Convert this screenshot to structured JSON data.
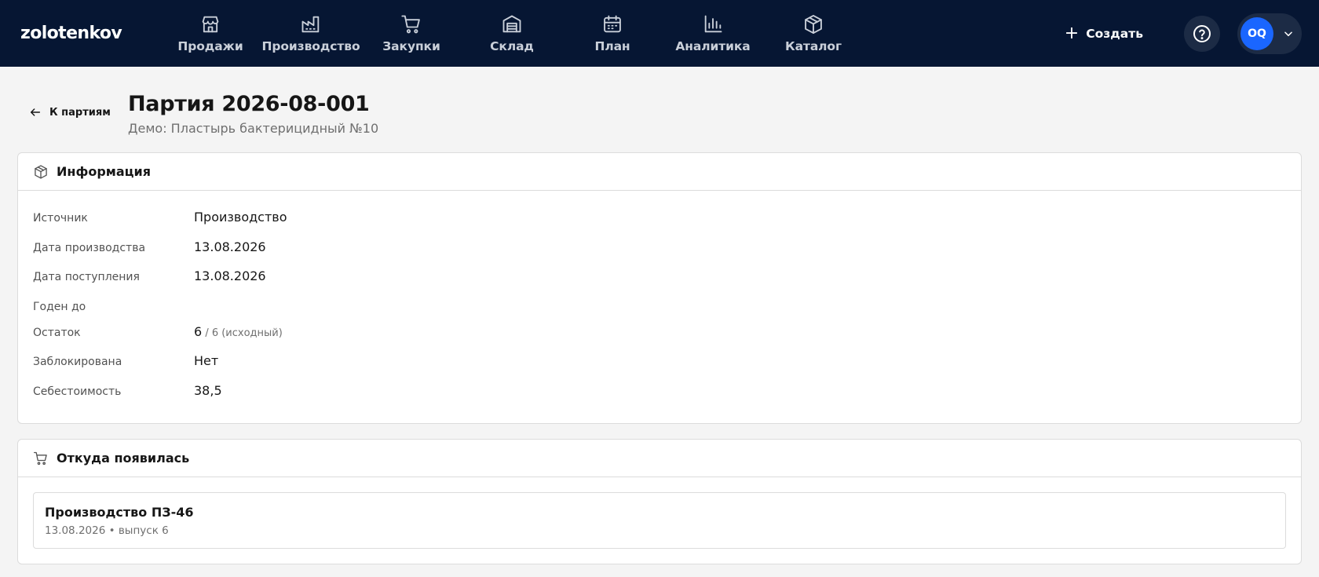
{
  "app": {
    "logo": "zolotenkov"
  },
  "nav": [
    {
      "id": "sales",
      "label": "Продажи",
      "icon": "store-icon"
    },
    {
      "id": "production",
      "label": "Производство",
      "icon": "factory-icon"
    },
    {
      "id": "purchases",
      "label": "Закупки",
      "icon": "cart-icon"
    },
    {
      "id": "warehouse",
      "label": "Склад",
      "icon": "warehouse-icon"
    },
    {
      "id": "plan",
      "label": "План",
      "icon": "calendar-icon"
    },
    {
      "id": "analytics",
      "label": "Аналитика",
      "icon": "bar-chart-icon"
    },
    {
      "id": "catalog",
      "label": "Каталог",
      "icon": "package-icon"
    }
  ],
  "header": {
    "create_label": "Создать",
    "user_initials": "OQ"
  },
  "page": {
    "back_label": "К партиям",
    "title": "Партия 2026-08-001",
    "subtitle": "Демо: Пластырь бактерицидный №10"
  },
  "info": {
    "title": "Информация",
    "rows": [
      {
        "label": "Источник",
        "value": "Производство"
      },
      {
        "label": "Дата производства",
        "value": "13.08.2026"
      },
      {
        "label": "Дата поступления",
        "value": "13.08.2026"
      },
      {
        "label": "Годен до",
        "value": ""
      },
      {
        "label": "Остаток",
        "value": "6",
        "sub": " / 6 (исходный)"
      },
      {
        "label": "Заблокирована",
        "value": "Нет"
      },
      {
        "label": "Себестоимость",
        "value": "38,5"
      }
    ]
  },
  "origin": {
    "title": "Откуда появилась",
    "items": [
      {
        "title": "Производство ПЗ-46",
        "meta": "13.08.2026 • выпуск 6"
      }
    ]
  },
  "colors": {
    "topbar": "#061633",
    "accent": "#1a66ff",
    "background": "#f4f4f4"
  }
}
